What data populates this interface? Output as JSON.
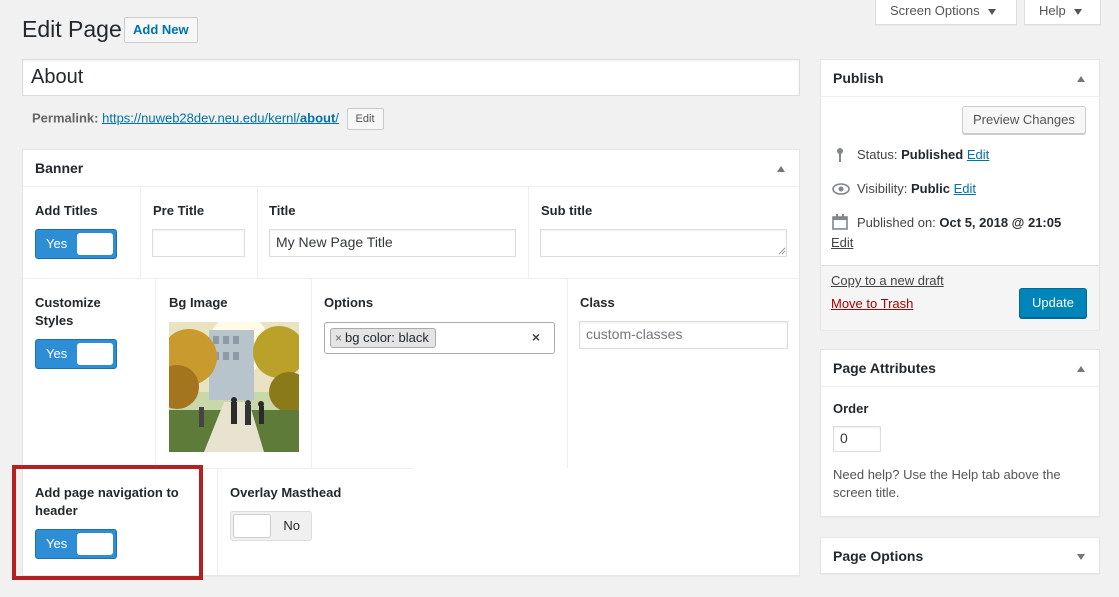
{
  "header": {
    "title": "Edit Page",
    "add_new": "Add New",
    "screen_options": "Screen Options",
    "help": "Help"
  },
  "post": {
    "title": "About",
    "permalink_label": "Permalink:",
    "permalink_base": "https://nuweb28dev.neu.edu/kernl/",
    "permalink_slug": "about",
    "permalink_trail": "/",
    "permalink_edit": "Edit"
  },
  "banner": {
    "heading": "Banner",
    "add_titles": {
      "label": "Add Titles",
      "toggle": "Yes"
    },
    "pre_title": {
      "label": "Pre Title",
      "value": ""
    },
    "title": {
      "label": "Title",
      "value": "My New Page Title"
    },
    "sub_title": {
      "label": "Sub title",
      "value": ""
    },
    "customize_styles": {
      "label_line1": "Customize",
      "label_line2": "Styles",
      "toggle": "Yes"
    },
    "bg_image": {
      "label": "Bg Image"
    },
    "options": {
      "label": "Options",
      "chip": "bg color: black",
      "chip_remove": "×",
      "clear": "×"
    },
    "class": {
      "label": "Class",
      "placeholder": "custom-classes"
    },
    "page_nav": {
      "label_line1": "Add page navigation to",
      "label_line2": "header",
      "toggle": "Yes"
    },
    "overlay": {
      "label": "Overlay Masthead",
      "toggle": "No"
    }
  },
  "publish": {
    "heading": "Publish",
    "preview": "Preview Changes",
    "status_label": "Status:",
    "status_value": "Published",
    "visibility_label": "Visibility:",
    "visibility_value": "Public",
    "published_label": "Published on:",
    "published_value": "Oct 5, 2018 @ 21:05",
    "edit": "Edit",
    "copy_draft": "Copy to a new draft",
    "trash": "Move to Trash",
    "update": "Update"
  },
  "page_attributes": {
    "heading": "Page Attributes",
    "order_label": "Order",
    "order_value": "0",
    "help_line1": "Need help? Use the Help tab above the",
    "help_line2": "screen title."
  },
  "page_options": {
    "heading": "Page Options"
  },
  "colors": {
    "accent": "#0085ba",
    "toggle_on": "#2d8ed6",
    "highlight": "#b32121",
    "link": "#0073aa",
    "trash": "#aa0000"
  }
}
